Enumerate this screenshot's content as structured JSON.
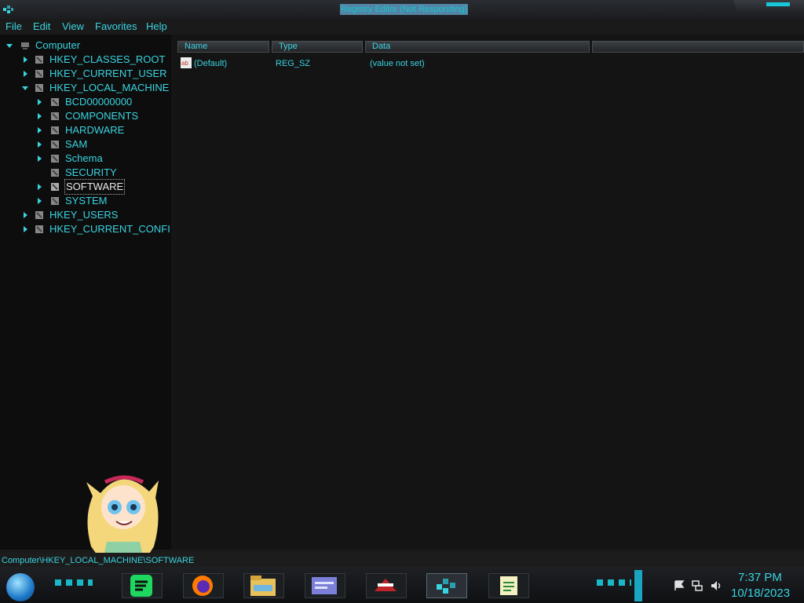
{
  "window": {
    "title": "Registry Editor (Not Responding)",
    "menu": [
      "File",
      "Edit",
      "View",
      "Favorites",
      "Help"
    ]
  },
  "tree": {
    "root": "Computer",
    "hives": {
      "classes_root": "HKEY_CLASSES_ROOT",
      "current_user": "HKEY_CURRENT_USER",
      "local_machine": "HKEY_LOCAL_MACHINE",
      "users": "HKEY_USERS",
      "current_config": "HKEY_CURRENT_CONFI"
    },
    "local_machine_children": [
      "BCD00000000",
      "COMPONENTS",
      "HARDWARE",
      "SAM",
      "Schema",
      "SECURITY",
      "SOFTWARE",
      "SYSTEM"
    ],
    "selected": "SOFTWARE"
  },
  "list": {
    "columns": [
      "Name",
      "Type",
      "Data"
    ],
    "rows": [
      {
        "name": "(Default)",
        "type": "REG_SZ",
        "data": "(value not set)"
      }
    ]
  },
  "status": {
    "path": "Computer\\HKEY_LOCAL_MACHINE\\SOFTWARE"
  },
  "taskbar": {
    "time": "7:37 PM",
    "date": "10/18/2023",
    "apps": [
      "spotify-icon",
      "firefox-icon",
      "file-explorer-icon",
      "control-panel-icon",
      "media-app-icon",
      "registry-editor-icon",
      "notepad-icon"
    ]
  },
  "colors": {
    "accent": "#3ad3e0",
    "background": "#1a1a1a"
  }
}
